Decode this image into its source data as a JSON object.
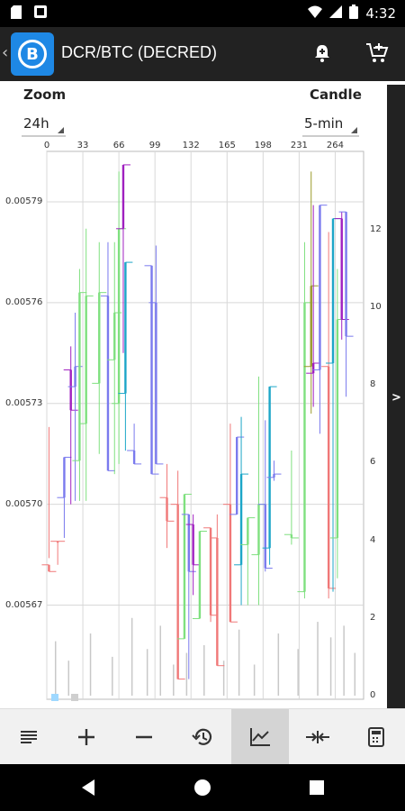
{
  "status_bar": {
    "time": "4:32",
    "icons": [
      "sd-card-icon",
      "wallet-icon",
      "wifi-icon",
      "signal-icon",
      "battery-icon"
    ]
  },
  "app_bar": {
    "back_label": "‹",
    "logo_letter": "B",
    "title": "DCR/BTC (DECRED)",
    "icons": [
      "alert-bell-icon",
      "cart-icon"
    ]
  },
  "controls": {
    "zoom_label": "Zoom",
    "zoom_value": "24h",
    "candle_label": "Candle",
    "candle_value": "5-min"
  },
  "side_panel": {
    "toggle_label": ">"
  },
  "toolbar": {
    "items": [
      "list-icon",
      "zoom-in-icon",
      "zoom-out-icon",
      "history-icon",
      "line-chart-icon",
      "compare-icon",
      "calculator-icon"
    ],
    "active": "line-chart-icon"
  },
  "colors": {
    "up": "#7fe07f",
    "down": "#f07878",
    "blue": "#7a7aee",
    "cyan": "#1ca6c8",
    "magenta": "#a020c0",
    "olive": "#9a9a2a",
    "volume": "#c8c8c8",
    "grid": "#d8d8d8"
  },
  "chart_data": {
    "type": "candlestick",
    "x_ticks": [
      "0",
      "33",
      "66",
      "99",
      "132",
      "165",
      "198",
      "231",
      "264"
    ],
    "y_left_ticks": [
      "0.00579",
      "0.00576",
      "0.00573",
      "0.00570",
      "0.00567"
    ],
    "y_right_ticks": [
      "12",
      "10",
      "8",
      "6",
      "4",
      "2",
      "0"
    ],
    "price_range": [
      0.005642,
      0.005805
    ],
    "x_range": [
      0,
      290
    ],
    "volume_range": [
      0,
      12.5
    ],
    "candles": [
      {
        "x": 2,
        "low": 0.005684,
        "high": 0.005723,
        "open": 0.005682,
        "close": 0.00568,
        "color": "down"
      },
      {
        "x": 10,
        "low": 0.005682,
        "high": 0.005689,
        "open": 0.005689,
        "close": 0.005689,
        "color": "down"
      },
      {
        "x": 16,
        "low": 0.00569,
        "high": 0.005714,
        "open": 0.005702,
        "close": 0.005714,
        "color": "blue"
      },
      {
        "x": 22,
        "low": 0.0057,
        "high": 0.005747,
        "open": 0.00574,
        "close": 0.005728,
        "color": "magenta"
      },
      {
        "x": 26,
        "low": 0.005701,
        "high": 0.005757,
        "open": 0.005735,
        "close": 0.005741,
        "color": "blue"
      },
      {
        "x": 30,
        "low": 0.005701,
        "high": 0.00577,
        "open": 0.005713,
        "close": 0.005763,
        "color": "up"
      },
      {
        "x": 36,
        "low": 0.005701,
        "high": 0.005782,
        "open": 0.005724,
        "close": 0.005762,
        "color": "up"
      },
      {
        "x": 48,
        "low": 0.005715,
        "high": 0.005778,
        "open": 0.005736,
        "close": 0.005763,
        "color": "up"
      },
      {
        "x": 56,
        "low": 0.00571,
        "high": 0.005778,
        "open": 0.005762,
        "close": 0.00571,
        "color": "blue"
      },
      {
        "x": 62,
        "low": 0.005709,
        "high": 0.005778,
        "open": 0.005743,
        "close": 0.005757,
        "color": "up"
      },
      {
        "x": 66,
        "low": 0.005712,
        "high": 0.005799,
        "open": 0.00573,
        "close": 0.005782,
        "color": "up"
      },
      {
        "x": 70,
        "low": 0.005745,
        "high": 0.005801,
        "open": 0.005782,
        "close": 0.005801,
        "color": "magenta"
      },
      {
        "x": 72,
        "low": 0.005716,
        "high": 0.005772,
        "open": 0.005733,
        "close": 0.005772,
        "color": "cyan"
      },
      {
        "x": 80,
        "low": 0.005712,
        "high": 0.005724,
        "open": 0.005716,
        "close": 0.005712,
        "color": "blue"
      },
      {
        "x": 96,
        "low": 0.005709,
        "high": 0.005771,
        "open": 0.005771,
        "close": 0.005709,
        "color": "blue"
      },
      {
        "x": 100,
        "low": 0.005712,
        "high": 0.005777,
        "open": 0.00576,
        "close": 0.005712,
        "color": "blue"
      },
      {
        "x": 110,
        "low": 0.005687,
        "high": 0.005712,
        "open": 0.005702,
        "close": 0.005695,
        "color": "down"
      },
      {
        "x": 120,
        "low": 0.005648,
        "high": 0.00571,
        "open": 0.0057,
        "close": 0.005648,
        "color": "down"
      },
      {
        "x": 126,
        "low": 0.00566,
        "high": 0.005703,
        "open": 0.00566,
        "close": 0.005703,
        "color": "up"
      },
      {
        "x": 130,
        "low": 0.005648,
        "high": 0.005697,
        "open": 0.005697,
        "close": 0.00568,
        "color": "blue"
      },
      {
        "x": 134,
        "low": 0.005673,
        "high": 0.005697,
        "open": 0.005694,
        "close": 0.005682,
        "color": "magenta"
      },
      {
        "x": 140,
        "low": 0.005666,
        "high": 0.005692,
        "open": 0.005666,
        "close": 0.005692,
        "color": "up"
      },
      {
        "x": 150,
        "low": 0.005665,
        "high": 0.005693,
        "open": 0.005693,
        "close": 0.005667,
        "color": "down"
      },
      {
        "x": 156,
        "low": 0.005652,
        "high": 0.005697,
        "open": 0.00569,
        "close": 0.005652,
        "color": "down"
      },
      {
        "x": 168,
        "low": 0.005665,
        "high": 0.005724,
        "open": 0.0057,
        "close": 0.005665,
        "color": "down"
      },
      {
        "x": 174,
        "low": 0.005697,
        "high": 0.00572,
        "open": 0.005697,
        "close": 0.00572,
        "color": "blue"
      },
      {
        "x": 178,
        "low": 0.00567,
        "high": 0.005726,
        "open": 0.005682,
        "close": 0.005709,
        "color": "cyan"
      },
      {
        "x": 184,
        "low": 0.00567,
        "high": 0.005696,
        "open": 0.005688,
        "close": 0.005696,
        "color": "up"
      },
      {
        "x": 194,
        "low": 0.00567,
        "high": 0.005738,
        "open": 0.005685,
        "close": 0.0057,
        "color": "up"
      },
      {
        "x": 200,
        "low": 0.00568,
        "high": 0.005725,
        "open": 0.0057,
        "close": 0.005681,
        "color": "blue"
      },
      {
        "x": 204,
        "low": 0.005682,
        "high": 0.005735,
        "open": 0.005687,
        "close": 0.005735,
        "color": "cyan"
      },
      {
        "x": 208,
        "low": 0.005707,
        "high": 0.005713,
        "open": 0.005708,
        "close": 0.005709,
        "color": "blue"
      },
      {
        "x": 224,
        "low": 0.005688,
        "high": 0.005716,
        "open": 0.005691,
        "close": 0.00569,
        "color": "up"
      },
      {
        "x": 236,
        "low": 0.005672,
        "high": 0.005778,
        "open": 0.005674,
        "close": 0.00576,
        "color": "up"
      },
      {
        "x": 242,
        "low": 0.005727,
        "high": 0.005799,
        "open": 0.005741,
        "close": 0.005765,
        "color": "olive"
      },
      {
        "x": 244,
        "low": 0.005729,
        "high": 0.005789,
        "open": 0.005739,
        "close": 0.005742,
        "color": "magenta"
      },
      {
        "x": 250,
        "low": 0.005721,
        "high": 0.005789,
        "open": 0.00574,
        "close": 0.005789,
        "color": "blue"
      },
      {
        "x": 258,
        "low": 0.005672,
        "high": 0.005781,
        "open": 0.005741,
        "close": 0.005675,
        "color": "down"
      },
      {
        "x": 262,
        "low": 0.005674,
        "high": 0.005785,
        "open": 0.005742,
        "close": 0.005785,
        "color": "cyan"
      },
      {
        "x": 266,
        "low": 0.005678,
        "high": 0.00577,
        "open": 0.00569,
        "close": 0.005755,
        "color": "up"
      },
      {
        "x": 270,
        "low": 0.005749,
        "high": 0.005787,
        "open": 0.005785,
        "close": 0.005755,
        "color": "magenta"
      },
      {
        "x": 274,
        "low": 0.005732,
        "high": 0.005787,
        "open": 0.005787,
        "close": 0.00575,
        "color": "blue"
      }
    ],
    "volumes": [
      {
        "x": 8,
        "v": 1.4
      },
      {
        "x": 20,
        "v": 0.9
      },
      {
        "x": 40,
        "v": 1.6
      },
      {
        "x": 60,
        "v": 1.0
      },
      {
        "x": 78,
        "v": 2.0
      },
      {
        "x": 92,
        "v": 1.2
      },
      {
        "x": 104,
        "v": 1.8
      },
      {
        "x": 116,
        "v": 0.8
      },
      {
        "x": 128,
        "v": 1.1
      },
      {
        "x": 144,
        "v": 1.3
      },
      {
        "x": 162,
        "v": 0.9
      },
      {
        "x": 176,
        "v": 1.7
      },
      {
        "x": 190,
        "v": 0.8
      },
      {
        "x": 212,
        "v": 1.6
      },
      {
        "x": 230,
        "v": 1.2
      },
      {
        "x": 248,
        "v": 1.9
      },
      {
        "x": 260,
        "v": 1.5
      },
      {
        "x": 272,
        "v": 1.8
      },
      {
        "x": 282,
        "v": 1.1
      }
    ]
  }
}
